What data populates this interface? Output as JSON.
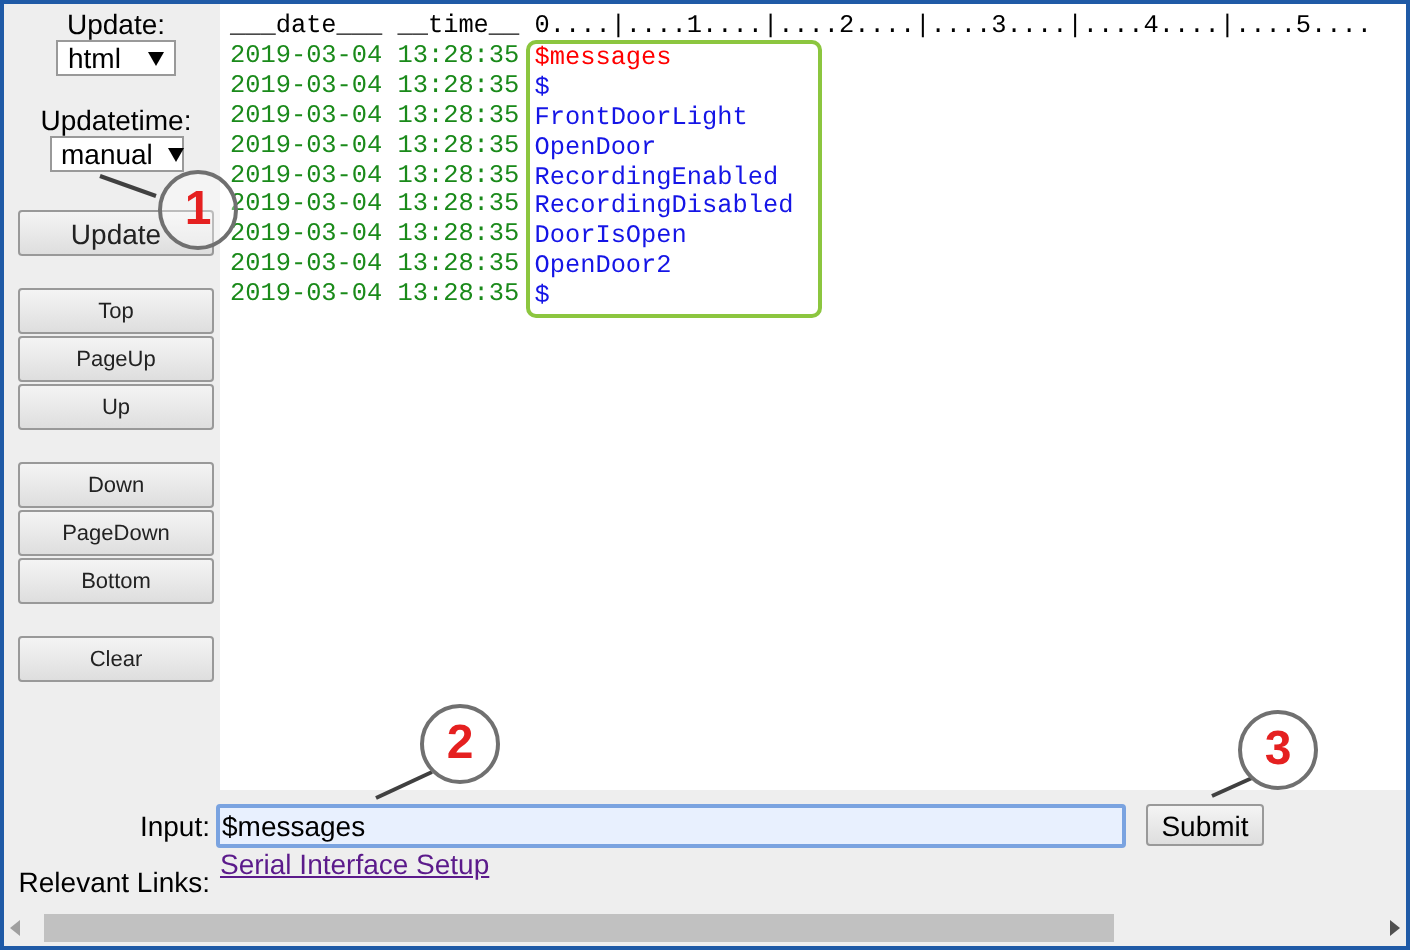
{
  "sidebar": {
    "update": {
      "label": "Update:",
      "value": "html"
    },
    "updatetime": {
      "label": "Updatetime:",
      "value": "manual"
    },
    "button_groups": [
      [
        "Update"
      ],
      [
        "Top",
        "PageUp",
        "Up"
      ],
      [
        "Down",
        "PageDown",
        "Bottom"
      ],
      [
        "Clear"
      ]
    ]
  },
  "log": {
    "header": {
      "date": "___date___",
      "time": "__time__",
      "ruler": "0....|....1....|....2....|....3....|....4....|....5...."
    },
    "rows": [
      {
        "date": "2019-03-04",
        "time": "13:28:35",
        "message": "$messages",
        "kind": "command"
      },
      {
        "date": "2019-03-04",
        "time": "13:28:35",
        "message": "$",
        "kind": "response"
      },
      {
        "date": "2019-03-04",
        "time": "13:28:35",
        "message": "FrontDoorLight",
        "kind": "response"
      },
      {
        "date": "2019-03-04",
        "time": "13:28:35",
        "message": "OpenDoor",
        "kind": "response"
      },
      {
        "date": "2019-03-04",
        "time": "13:28:35",
        "message": "RecordingEnabled",
        "kind": "response"
      },
      {
        "date": "2019-03-04",
        "time": "13:28:35",
        "message": "RecordingDisabled",
        "kind": "response"
      },
      {
        "date": "2019-03-04",
        "time": "13:28:35",
        "message": "DoorIsOpen",
        "kind": "response"
      },
      {
        "date": "2019-03-04",
        "time": "13:28:35",
        "message": "OpenDoor2",
        "kind": "response"
      },
      {
        "date": "2019-03-04",
        "time": "13:28:35",
        "message": "$",
        "kind": "response"
      }
    ]
  },
  "input": {
    "label": "Input:",
    "value": "$messages",
    "submit": "Submit"
  },
  "links": {
    "label": "Relevant Links:",
    "items": [
      "Serial Interface Setup"
    ]
  },
  "callouts": [
    {
      "number": "1"
    },
    {
      "number": "2"
    },
    {
      "number": "3"
    }
  ]
}
